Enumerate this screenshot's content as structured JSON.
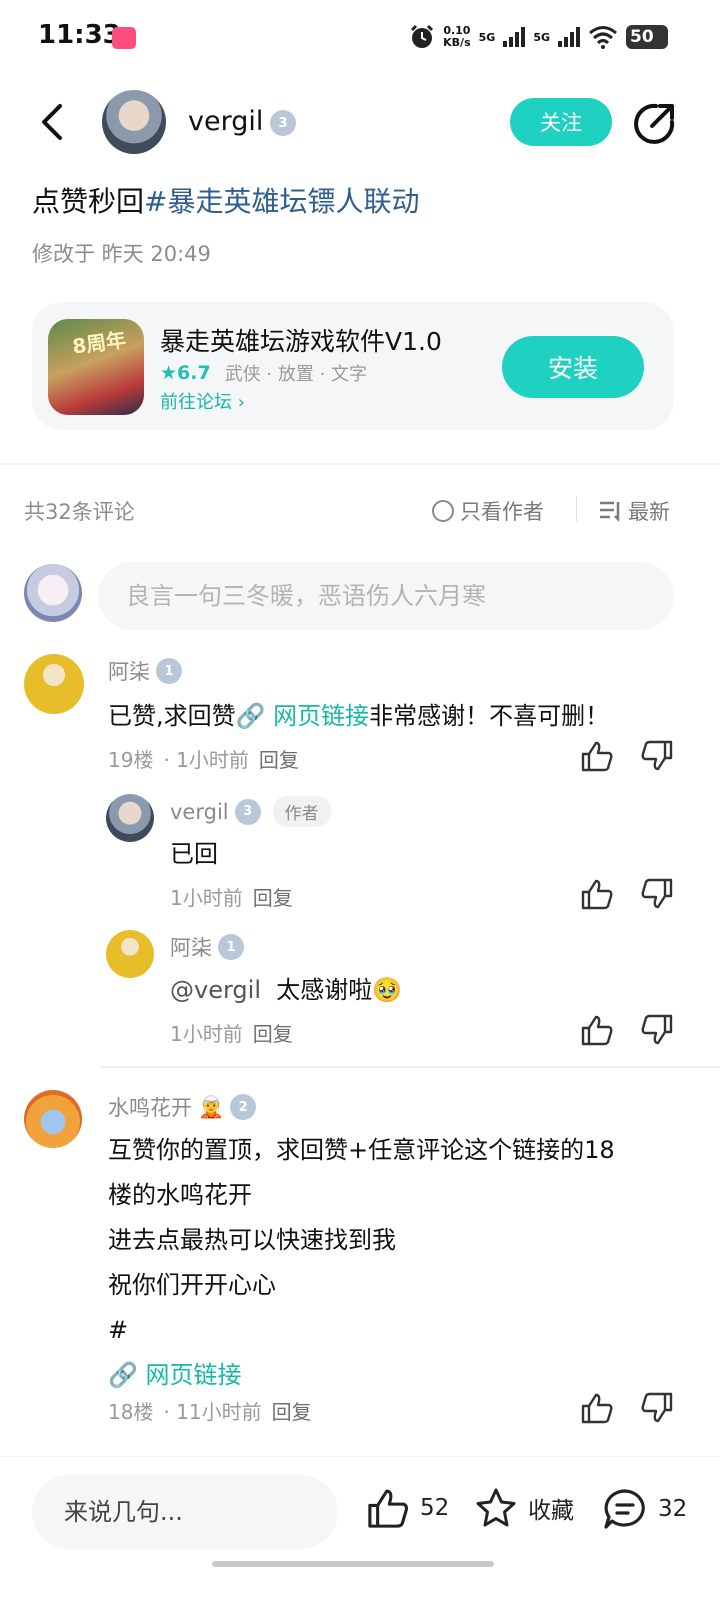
{
  "status_bar": {
    "time": "11:33",
    "net_speed_value": "0.10",
    "net_speed_unit": "KB/s",
    "signal1": "5G",
    "signal2": "5G",
    "battery": "50"
  },
  "header": {
    "username": "vergil",
    "level": "3",
    "follow_label": "关注",
    "icons": [
      "back-arrow-icon",
      "share-icon"
    ]
  },
  "post": {
    "title_prefix": "点赞秒回",
    "title_tag": "#暴走英雄坛镖人联动",
    "modified": "修改于 昨天 20:49"
  },
  "app_card": {
    "icon_text": "8周年",
    "name": "暴走英雄坛游戏软件V1.0",
    "rating": "★6.7",
    "tags": "武侠 · 放置 · 文字",
    "forum_link": "前往论坛 ›",
    "install_label": "安装"
  },
  "comments_bar": {
    "count": "共32条评论",
    "author_only": "只看作者",
    "sort": "最新"
  },
  "comment_input": {
    "placeholder": "良言一句三冬暖，恶语伤人六月寒"
  },
  "comments": [
    {
      "user": "阿柒",
      "level": "1",
      "text_prefix": "已赞,求回赞",
      "link": "🔗 网页链接",
      "text_suffix": "非常感谢！不喜可删！",
      "floor": "19楼",
      "time": "· 1小时前",
      "reply": "回复"
    },
    {
      "user": "vergil",
      "level": "3",
      "author_tag": "作者",
      "text": "已回",
      "time": "1小时前",
      "reply": "回复"
    },
    {
      "user": "阿柒",
      "level": "1",
      "mention": "@vergil",
      "text": "太感谢啦🥹",
      "time": "1小时前",
      "reply": "回复"
    },
    {
      "user": "水鸣花开",
      "emoji": "🧝",
      "level": "2",
      "lines": [
        "互赞你的置顶，求回赞+任意评论这个链接的18",
        "楼的水鸣花开",
        "进去点最热可以快速找到我",
        "祝你们开开心心",
        "#"
      ],
      "link": "🔗 网页链接",
      "floor": "18楼",
      "time": "· 11小时前",
      "reply": "回复"
    }
  ],
  "bottom_bar": {
    "placeholder": "来说几句...",
    "likes": "52",
    "collect": "收藏",
    "comments": "32"
  },
  "colors": {
    "accent": "#1fd1c1",
    "tag_blue": "#2f5f91",
    "link_teal": "#17b8a8"
  }
}
